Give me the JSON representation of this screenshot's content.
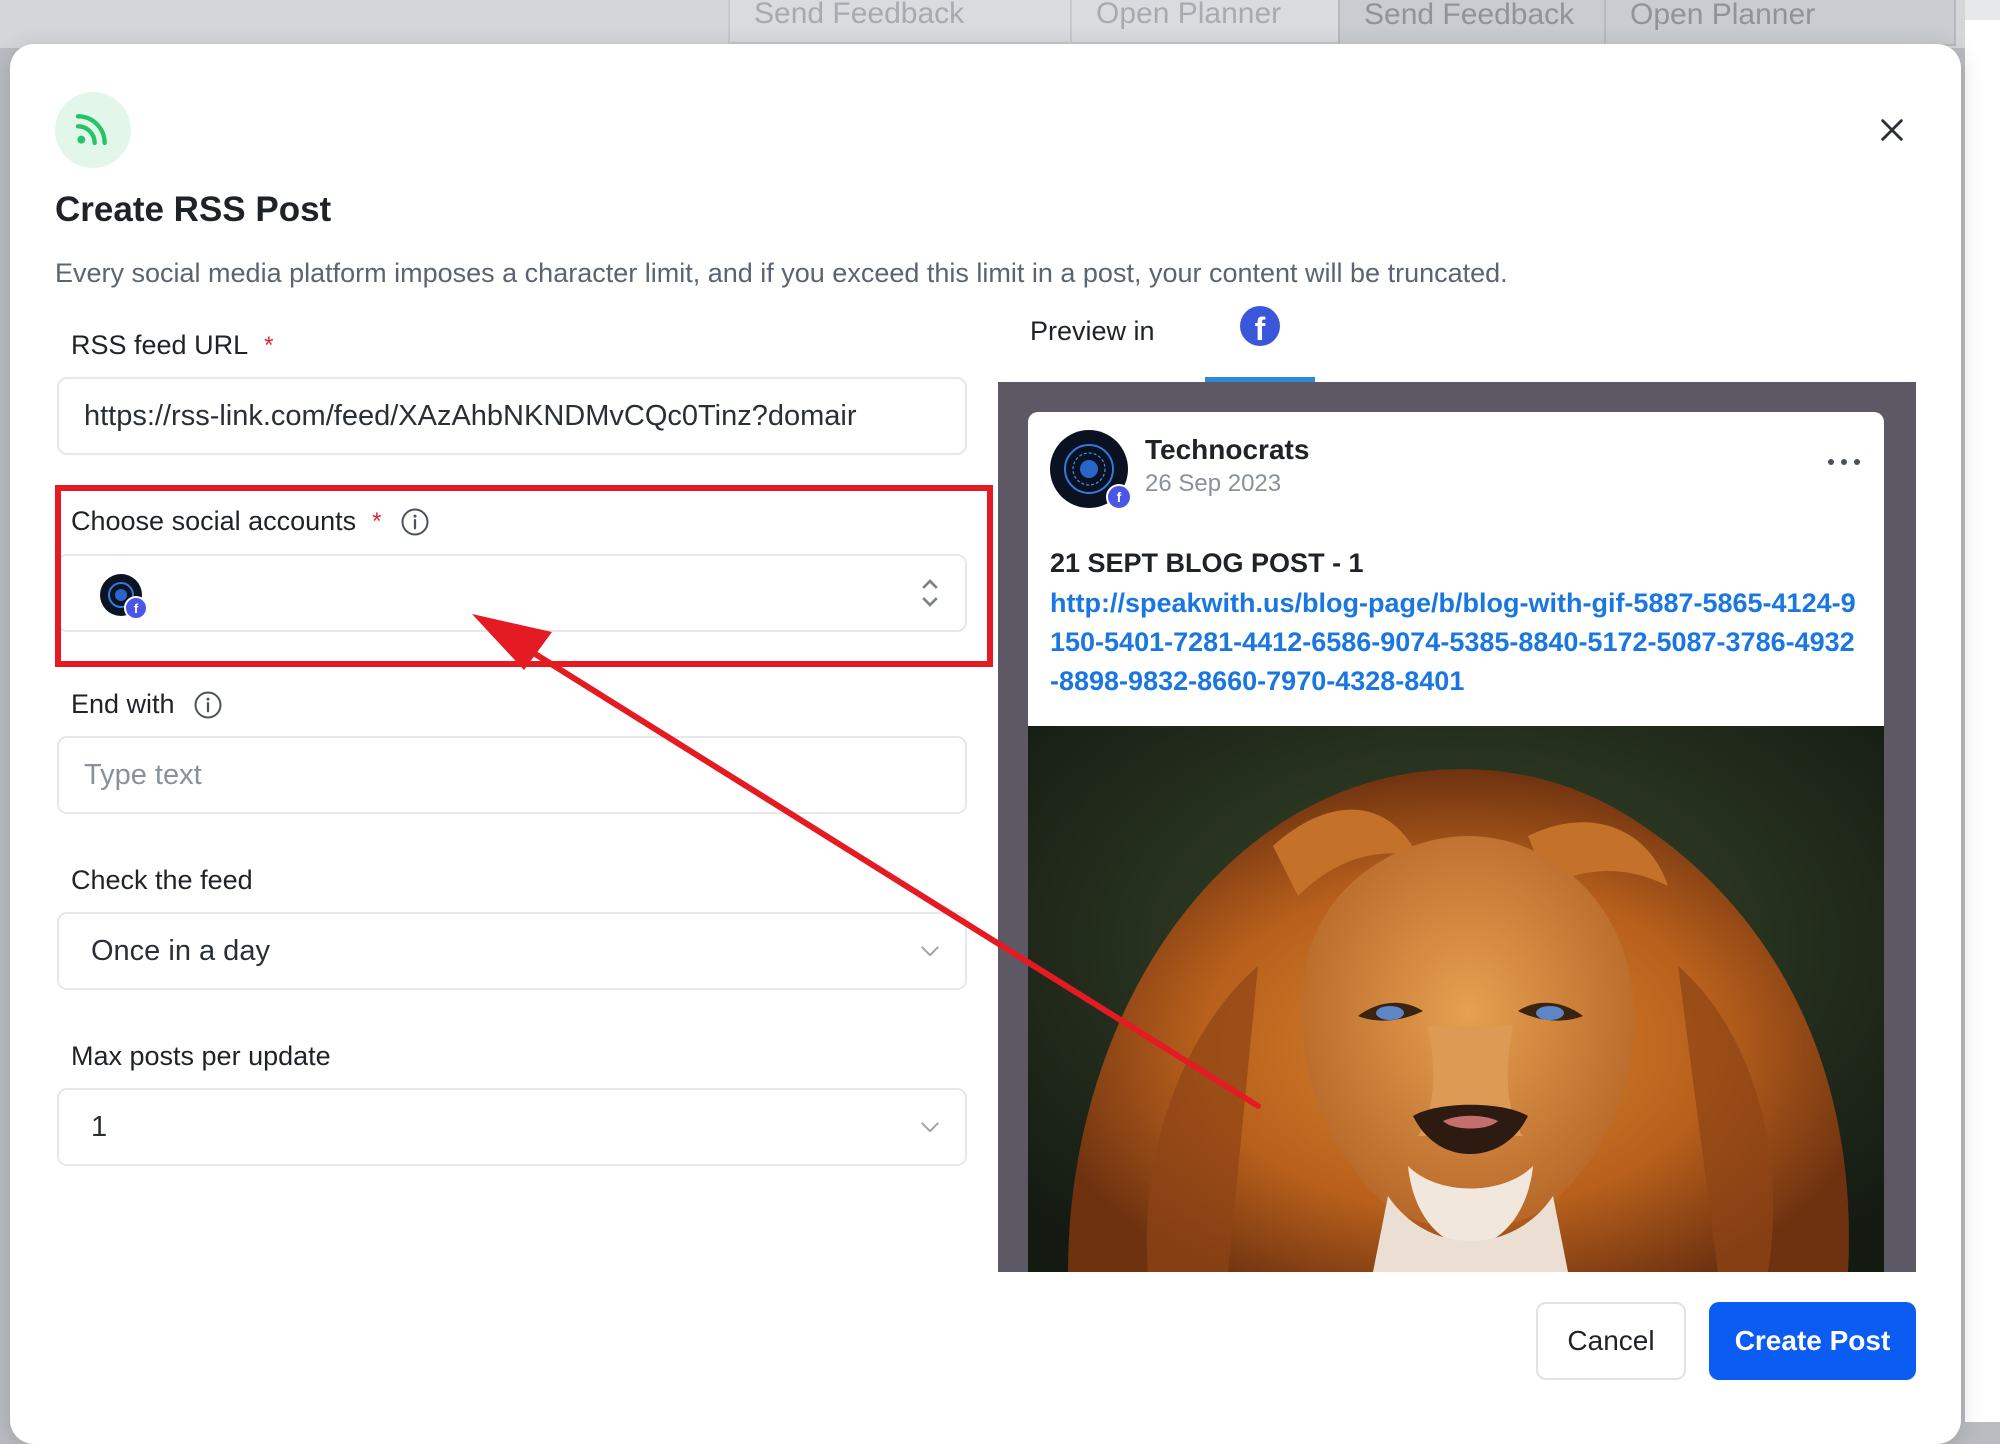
{
  "background": {
    "ghost_buttons": [
      "Send Feedback",
      "Open Planner"
    ]
  },
  "modal": {
    "title": "Create RSS Post",
    "subtitle": "Every social media platform imposes a character limit, and if you exceed this limit in a post, your content will be truncated.",
    "icons": {
      "header": "rss-icon",
      "close": "close-icon"
    }
  },
  "form": {
    "rss_url": {
      "label": "RSS feed URL",
      "required_mark": "*",
      "value": "https://rss-link.com/feed/XAzAhbNKNDMvCQc0Tinz?domair"
    },
    "social_accounts": {
      "label": "Choose social accounts",
      "required_mark": "*"
    },
    "end_with": {
      "label": "End with",
      "placeholder": "Type text"
    },
    "check_feed": {
      "label": "Check the feed",
      "value": "Once in a day"
    },
    "max_posts": {
      "label": "Max posts per update",
      "value": "1"
    }
  },
  "preview": {
    "label": "Preview in",
    "active_platform": "facebook",
    "post": {
      "account_name": "Technocrats",
      "date": "26 Sep 2023",
      "title": "21 SEPT BLOG POST - 1",
      "link": "http://speakwith.us/blog-page/b/blog-with-gif-5887-5865-4124-9150-5401-7281-4412-6586-9074-5385-8840-5172-5087-3786-4932-8898-9832-8660-7970-4328-8401"
    }
  },
  "buttons": {
    "cancel": "Cancel",
    "create": "Create Post"
  },
  "colors": {
    "primary": "#0b5cf3",
    "highlight": "#e41b23",
    "link": "#1b77e0",
    "rss_green": "#27c36a",
    "facebook": "#3b57d9"
  }
}
